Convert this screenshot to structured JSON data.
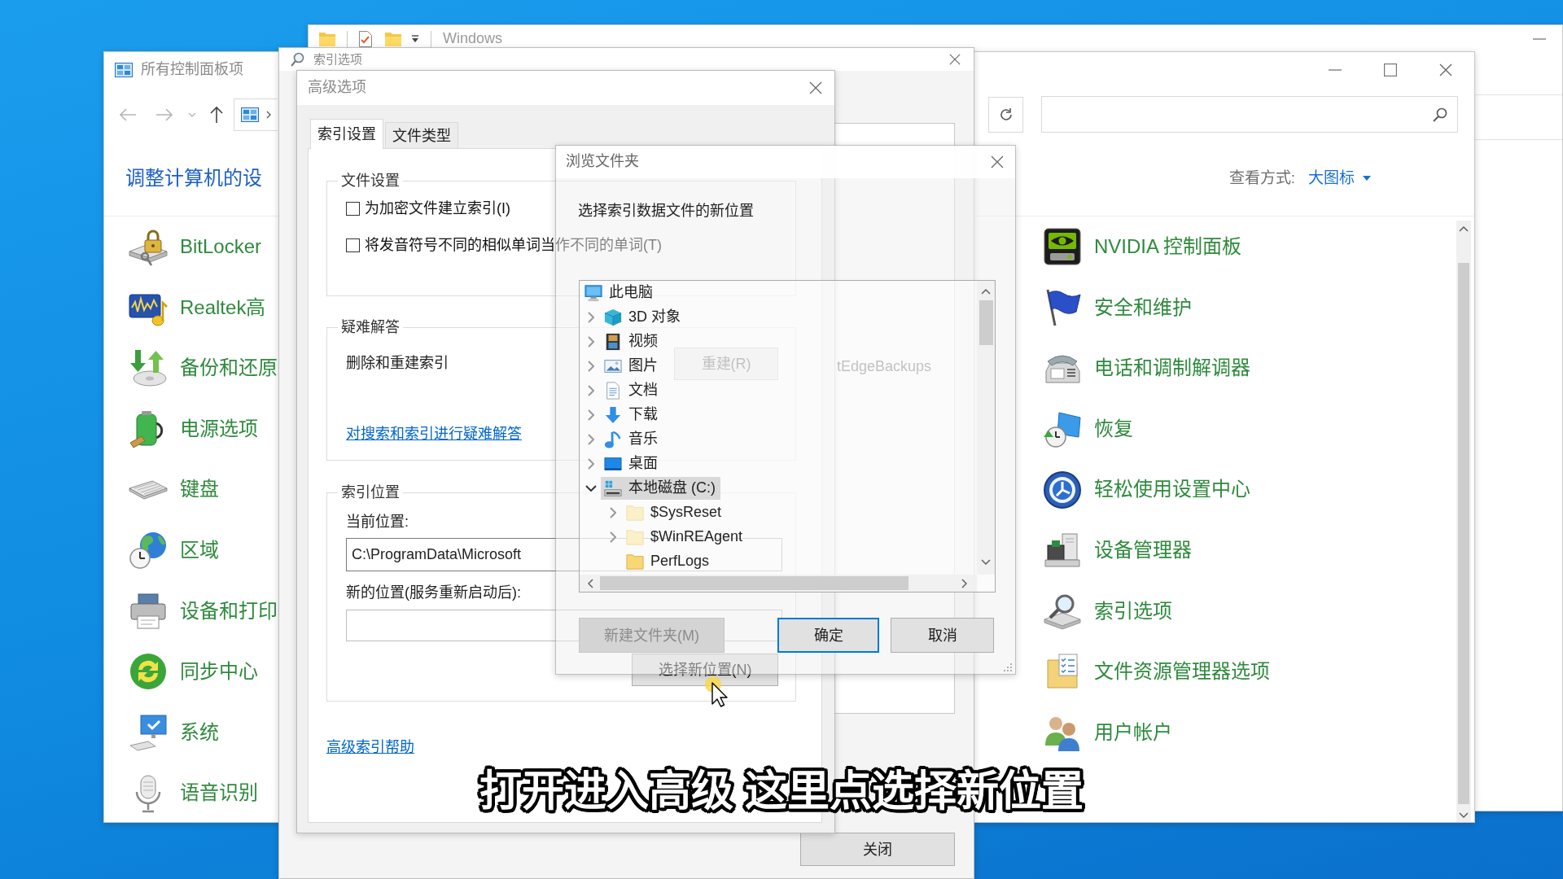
{
  "explorer_window": {
    "title": "Windows"
  },
  "control_panel": {
    "title": "所有控制面板项",
    "heading": "调整计算机的设",
    "view_by_label": "查看方式:",
    "view_by_value": "大图标",
    "left_items": [
      "BitLocker",
      "Realtek高",
      "备份和还原",
      "电源选项",
      "键盘",
      "区域",
      "设备和打印",
      "同步中心",
      "系统",
      "语音识别"
    ],
    "right_items": [
      "NVIDIA 控制面板",
      "安全和维护",
      "电话和调制解调器",
      "恢复",
      "轻松使用设置中心",
      "设备管理器",
      "索引选项",
      "文件资源管理器选项",
      "用户帐户"
    ]
  },
  "indexing_options": {
    "title": "索引选项",
    "list_item": "tEdgeBackups",
    "close_button": "关闭"
  },
  "advanced_options": {
    "title": "高级选项",
    "tabs": [
      {
        "label": "索引设置",
        "selected": true
      },
      {
        "label": "文件类型",
        "selected": false
      }
    ],
    "file_settings": {
      "legend": "文件设置",
      "checkboxes": [
        {
          "label": "为加密文件建立索引(I)",
          "checked": false
        },
        {
          "label": "将发音符号不同的相似单词当作不同的单词(T)",
          "checked": false
        }
      ]
    },
    "troubleshooting": {
      "legend": "疑难解答",
      "rebuild_text": "删除和重建索引",
      "rebuild_button": "重建(R)",
      "link": "对搜索和索引进行疑难解答"
    },
    "index_location": {
      "legend": "索引位置",
      "current_label": "当前位置:",
      "current_value": "C:\\ProgramData\\Microsoft",
      "new_label": "新的位置(服务重新启动后):",
      "select_button": "选择新位置(N)"
    },
    "help_link": "高级索引帮助"
  },
  "browse_dialog": {
    "title": "浏览文件夹",
    "description": "选择索引数据文件的新位置",
    "tree": [
      {
        "label": "此电脑",
        "expandable": false,
        "selected": false,
        "children": [
          {
            "label": "3D 对象",
            "expandable": true,
            "expanded": false,
            "selected": false
          },
          {
            "label": "视频",
            "expandable": true,
            "expanded": false,
            "selected": false
          },
          {
            "label": "图片",
            "expandable": true,
            "expanded": false,
            "selected": false
          },
          {
            "label": "文档",
            "expandable": true,
            "expanded": false,
            "selected": false
          },
          {
            "label": "下载",
            "expandable": true,
            "expanded": false,
            "selected": false
          },
          {
            "label": "音乐",
            "expandable": true,
            "expanded": false,
            "selected": false
          },
          {
            "label": "桌面",
            "expandable": true,
            "expanded": false,
            "selected": false
          },
          {
            "label": "本地磁盘 (C:)",
            "expandable": true,
            "expanded": true,
            "selected": true,
            "children": [
              {
                "label": "$SysReset",
                "expandable": true,
                "expanded": false,
                "selected": false,
                "hidden": true
              },
              {
                "label": "$WinREAgent",
                "expandable": true,
                "expanded": false,
                "selected": false,
                "hidden": true
              },
              {
                "label": "PerfLogs",
                "expandable": false,
                "selected": false,
                "hidden": false
              }
            ]
          }
        ]
      }
    ],
    "buttons": [
      {
        "label": "新建文件夹(M)",
        "disabled": true,
        "default": false
      },
      {
        "label": "确定",
        "disabled": false,
        "default": true
      },
      {
        "label": "取消",
        "disabled": false,
        "default": false
      }
    ]
  },
  "caption": "打开进入高级 这里点选择新位置"
}
